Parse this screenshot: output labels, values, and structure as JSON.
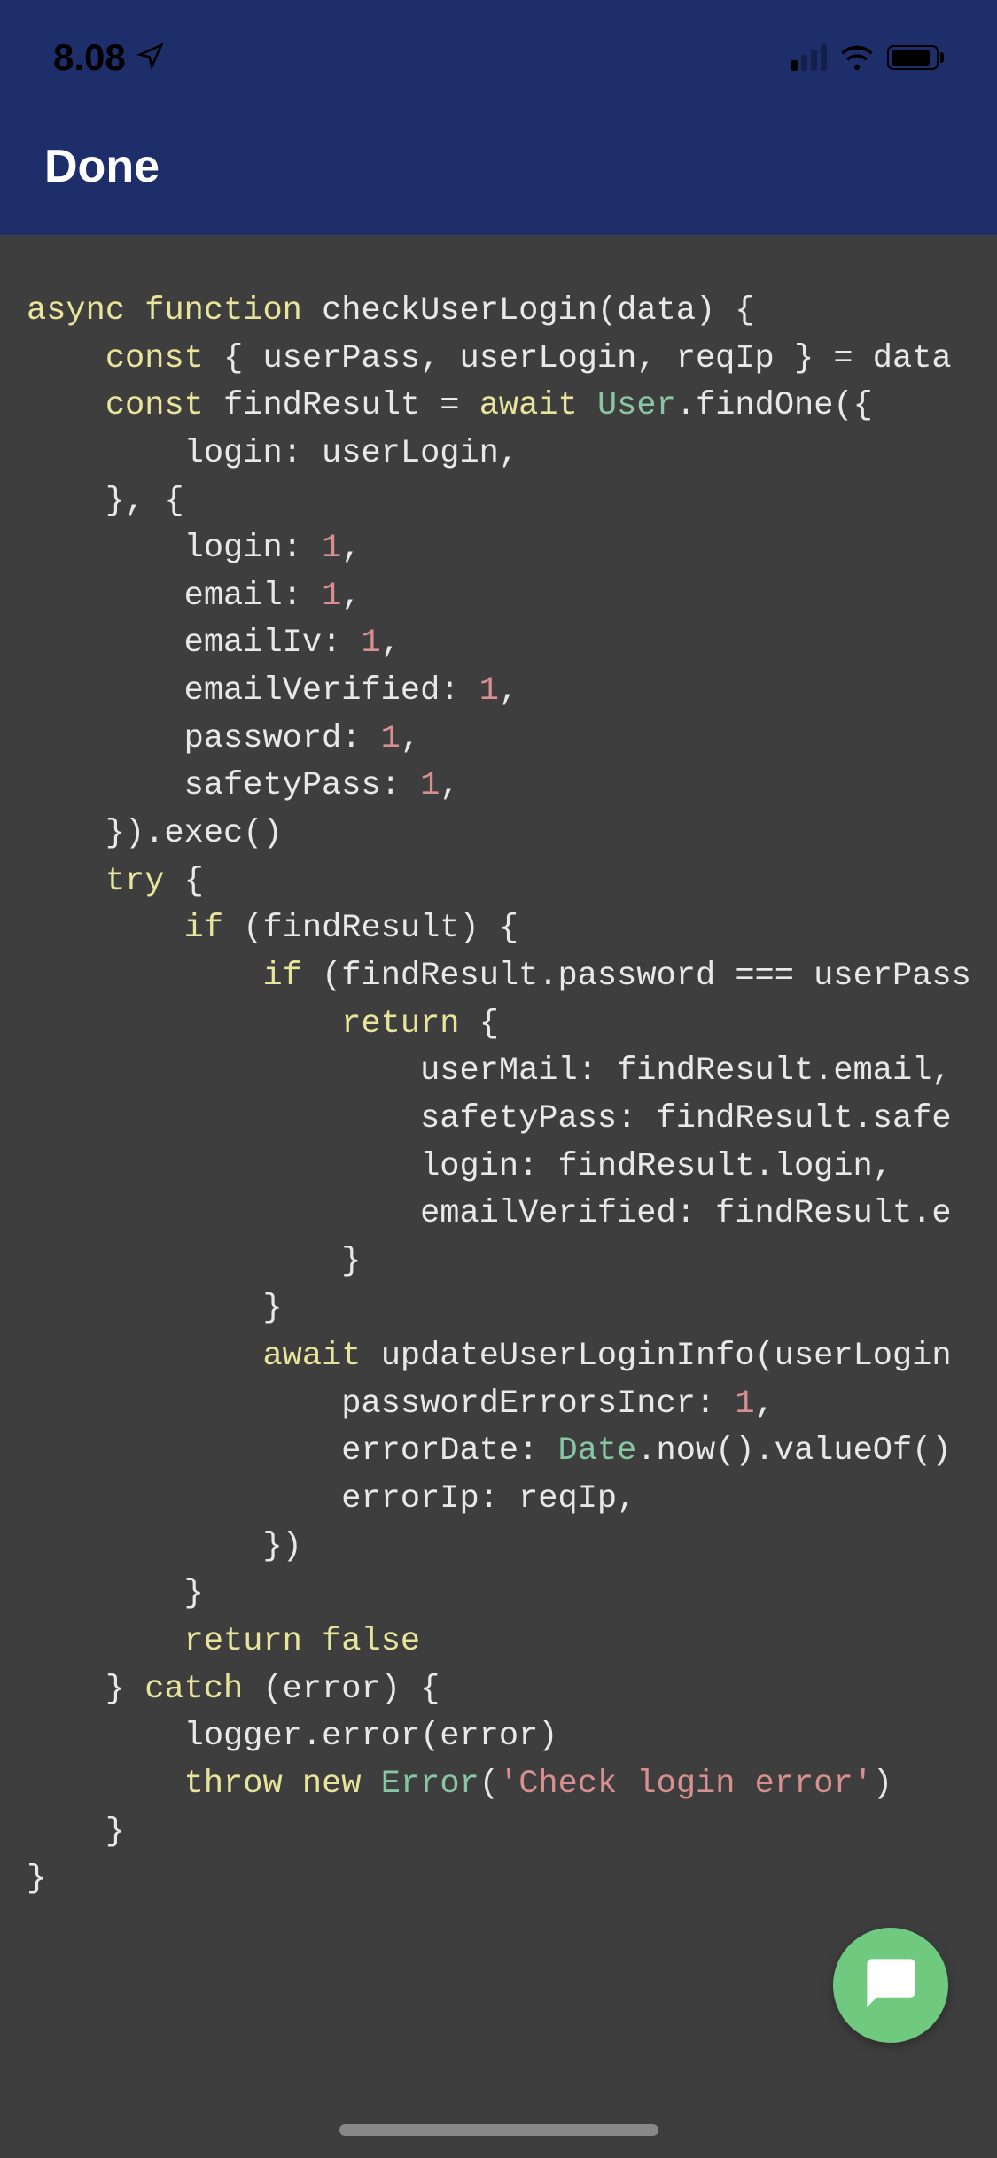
{
  "statusBar": {
    "time": "8.08",
    "batteryLevel": 90
  },
  "navBar": {
    "doneLabel": "Done"
  },
  "code": {
    "tokens": [
      {
        "t": "async",
        "c": "kw"
      },
      {
        "t": " ",
        "c": ""
      },
      {
        "t": "function",
        "c": "kw"
      },
      {
        "t": " checkUserLogin(data) {",
        "c": ""
      },
      {
        "t": "\n",
        "c": ""
      },
      {
        "t": "    ",
        "c": ""
      },
      {
        "t": "const",
        "c": "kw"
      },
      {
        "t": " { userPass, userLogin, reqIp } = data",
        "c": ""
      },
      {
        "t": "\n",
        "c": ""
      },
      {
        "t": "    ",
        "c": ""
      },
      {
        "t": "const",
        "c": "kw"
      },
      {
        "t": " findResult = ",
        "c": ""
      },
      {
        "t": "await",
        "c": "kw"
      },
      {
        "t": " ",
        "c": ""
      },
      {
        "t": "User",
        "c": "cls"
      },
      {
        "t": ".findOne({",
        "c": ""
      },
      {
        "t": "\n",
        "c": ""
      },
      {
        "t": "        login: userLogin,",
        "c": ""
      },
      {
        "t": "\n",
        "c": ""
      },
      {
        "t": "    }, {",
        "c": ""
      },
      {
        "t": "\n",
        "c": ""
      },
      {
        "t": "        login: ",
        "c": ""
      },
      {
        "t": "1",
        "c": "num"
      },
      {
        "t": ",",
        "c": ""
      },
      {
        "t": "\n",
        "c": ""
      },
      {
        "t": "        email: ",
        "c": ""
      },
      {
        "t": "1",
        "c": "num"
      },
      {
        "t": ",",
        "c": ""
      },
      {
        "t": "\n",
        "c": ""
      },
      {
        "t": "        emailIv: ",
        "c": ""
      },
      {
        "t": "1",
        "c": "num"
      },
      {
        "t": ",",
        "c": ""
      },
      {
        "t": "\n",
        "c": ""
      },
      {
        "t": "        emailVerified: ",
        "c": ""
      },
      {
        "t": "1",
        "c": "num"
      },
      {
        "t": ",",
        "c": ""
      },
      {
        "t": "\n",
        "c": ""
      },
      {
        "t": "        password: ",
        "c": ""
      },
      {
        "t": "1",
        "c": "num"
      },
      {
        "t": ",",
        "c": ""
      },
      {
        "t": "\n",
        "c": ""
      },
      {
        "t": "        safetyPass: ",
        "c": ""
      },
      {
        "t": "1",
        "c": "num"
      },
      {
        "t": ",",
        "c": ""
      },
      {
        "t": "\n",
        "c": ""
      },
      {
        "t": "    }).exec()",
        "c": ""
      },
      {
        "t": "\n",
        "c": ""
      },
      {
        "t": "    ",
        "c": ""
      },
      {
        "t": "try",
        "c": "kw"
      },
      {
        "t": " {",
        "c": ""
      },
      {
        "t": "\n",
        "c": ""
      },
      {
        "t": "        ",
        "c": ""
      },
      {
        "t": "if",
        "c": "kw"
      },
      {
        "t": " (findResult) {",
        "c": ""
      },
      {
        "t": "\n",
        "c": ""
      },
      {
        "t": "            ",
        "c": ""
      },
      {
        "t": "if",
        "c": "kw"
      },
      {
        "t": " (findResult.password === userPass",
        "c": ""
      },
      {
        "t": "\n",
        "c": ""
      },
      {
        "t": "                ",
        "c": ""
      },
      {
        "t": "return",
        "c": "kw"
      },
      {
        "t": " {",
        "c": ""
      },
      {
        "t": "\n",
        "c": ""
      },
      {
        "t": "                    userMail: findResult.email,",
        "c": ""
      },
      {
        "t": "\n",
        "c": ""
      },
      {
        "t": "                    safetyPass: findResult.safe",
        "c": ""
      },
      {
        "t": "\n",
        "c": ""
      },
      {
        "t": "                    login: findResult.login,",
        "c": ""
      },
      {
        "t": "\n",
        "c": ""
      },
      {
        "t": "                    emailVerified: findResult.e",
        "c": ""
      },
      {
        "t": "\n",
        "c": ""
      },
      {
        "t": "                }",
        "c": ""
      },
      {
        "t": "\n",
        "c": ""
      },
      {
        "t": "            }",
        "c": ""
      },
      {
        "t": "\n",
        "c": ""
      },
      {
        "t": "            ",
        "c": ""
      },
      {
        "t": "await",
        "c": "kw"
      },
      {
        "t": " updateUserLoginInfo(userLogin",
        "c": ""
      },
      {
        "t": "\n",
        "c": ""
      },
      {
        "t": "                passwordErrorsIncr: ",
        "c": ""
      },
      {
        "t": "1",
        "c": "num"
      },
      {
        "t": ",",
        "c": ""
      },
      {
        "t": "\n",
        "c": ""
      },
      {
        "t": "                errorDate: ",
        "c": ""
      },
      {
        "t": "Date",
        "c": "cls"
      },
      {
        "t": ".now().valueOf()",
        "c": ""
      },
      {
        "t": "\n",
        "c": ""
      },
      {
        "t": "                errorIp: reqIp,",
        "c": ""
      },
      {
        "t": "\n",
        "c": ""
      },
      {
        "t": "            })",
        "c": ""
      },
      {
        "t": "\n",
        "c": ""
      },
      {
        "t": "        }",
        "c": ""
      },
      {
        "t": "\n",
        "c": ""
      },
      {
        "t": "        ",
        "c": ""
      },
      {
        "t": "return",
        "c": "kw"
      },
      {
        "t": " ",
        "c": ""
      },
      {
        "t": "false",
        "c": "kw"
      },
      {
        "t": "\n",
        "c": ""
      },
      {
        "t": "    } ",
        "c": ""
      },
      {
        "t": "catch",
        "c": "kw"
      },
      {
        "t": " (error) {",
        "c": ""
      },
      {
        "t": "\n",
        "c": ""
      },
      {
        "t": "        logger.error(error)",
        "c": ""
      },
      {
        "t": "\n",
        "c": ""
      },
      {
        "t": "        ",
        "c": ""
      },
      {
        "t": "throw",
        "c": "kw"
      },
      {
        "t": " ",
        "c": ""
      },
      {
        "t": "new",
        "c": "kw"
      },
      {
        "t": " ",
        "c": ""
      },
      {
        "t": "Error",
        "c": "cls"
      },
      {
        "t": "(",
        "c": ""
      },
      {
        "t": "'Check login error'",
        "c": "str"
      },
      {
        "t": ")",
        "c": ""
      },
      {
        "t": "\n",
        "c": ""
      },
      {
        "t": "    }",
        "c": ""
      },
      {
        "t": "\n",
        "c": ""
      },
      {
        "t": "}",
        "c": ""
      }
    ]
  }
}
